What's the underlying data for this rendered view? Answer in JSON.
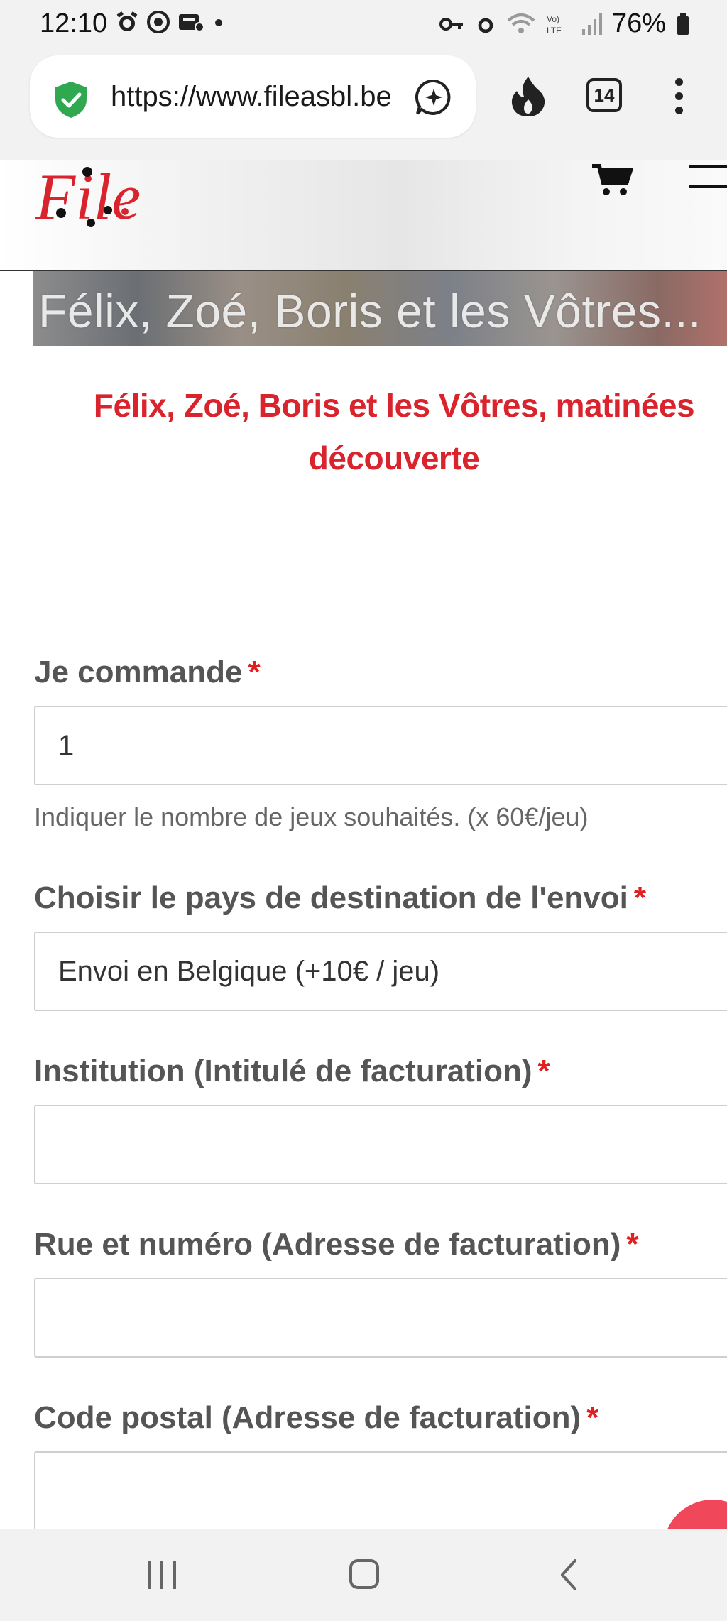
{
  "status_bar": {
    "time": "12:10",
    "battery": "76%",
    "left_icons": [
      "alarm-icon",
      "data-saver-icon",
      "notification-icon",
      "dot-icon"
    ],
    "right_icons": [
      "vpn-key-icon",
      "alarm-icon",
      "wifi-icon",
      "volte-icon",
      "signal-icon",
      "battery-icon"
    ]
  },
  "browser": {
    "url": "https://www.fileasbl.be",
    "tab_count": "14",
    "security_color": "#2fa84f"
  },
  "site": {
    "logo_text": "File",
    "banner_text": "Félix, Zoé, Boris et les Vôtres...",
    "title": "Félix, Zoé, Boris et les Vôtres, matinées découverte",
    "accent_color": "#d9232d"
  },
  "form": {
    "quantity": {
      "label": "Je commande",
      "required_mark": "*",
      "value": "1",
      "help": "Indiquer le nombre de jeux souhaités. (x 60€/jeu)"
    },
    "country": {
      "label": "Choisir le pays de destination de l'envoi",
      "required_mark": "*",
      "value": "Envoi en Belgique (+10€ / jeu)"
    },
    "institution": {
      "label": "Institution (Intitulé de facturation)",
      "required_mark": "*",
      "value": ""
    },
    "street": {
      "label": "Rue et numéro (Adresse de facturation)",
      "required_mark": "*",
      "value": ""
    },
    "postal_code": {
      "label": "Code postal (Adresse de facturation)",
      "required_mark": "*",
      "value": ""
    }
  },
  "nav_bar": {
    "buttons": [
      "recents-icon",
      "home-icon",
      "back-icon"
    ]
  }
}
